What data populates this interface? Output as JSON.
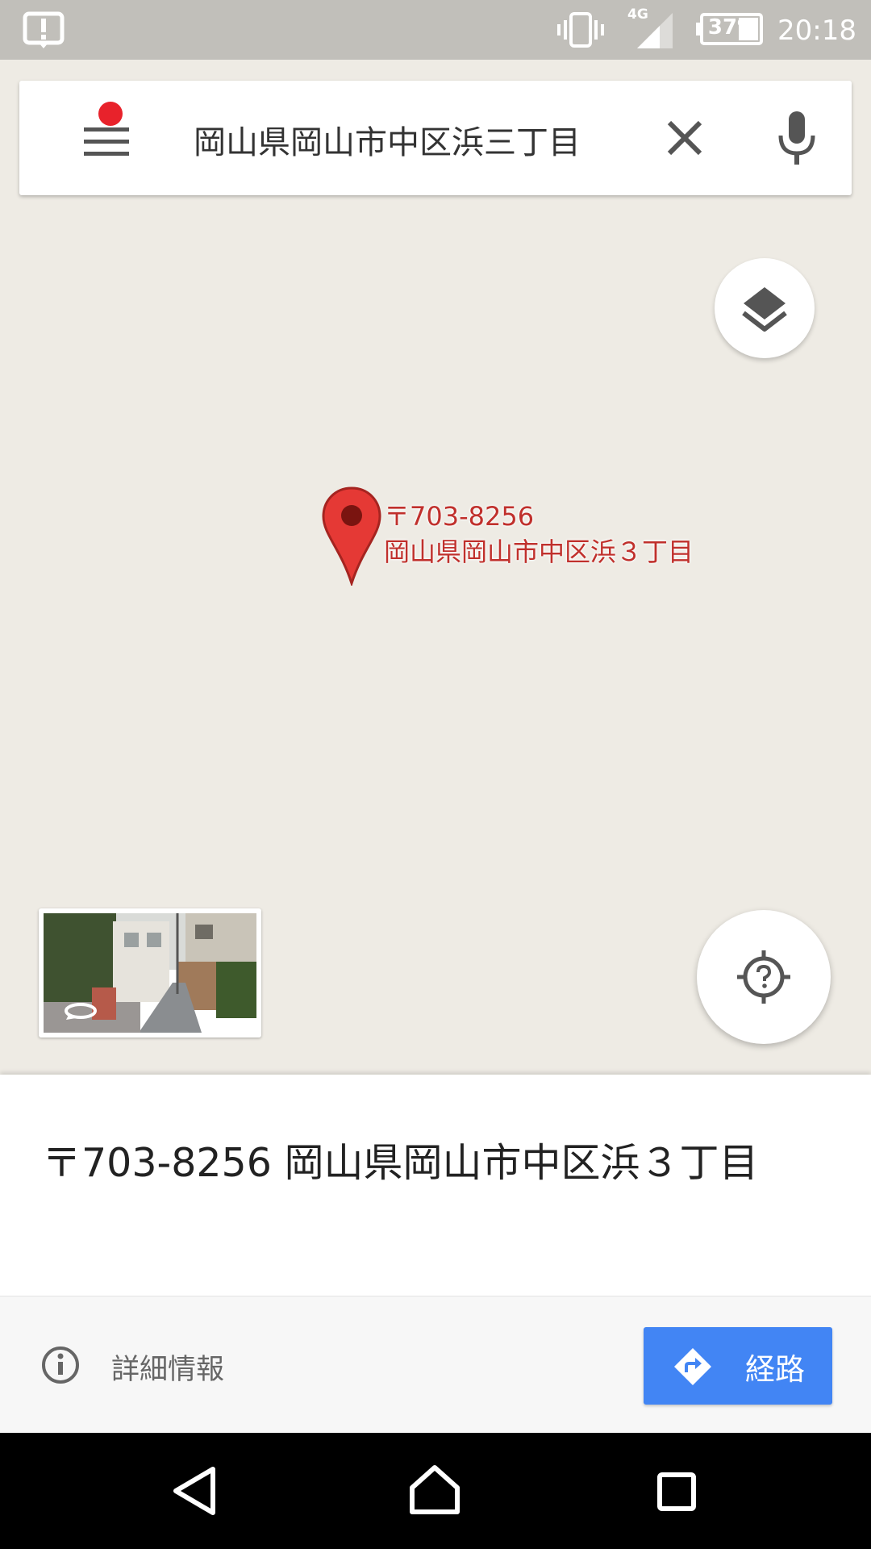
{
  "status_bar": {
    "alert_icon": "notification-alert-icon",
    "vibrate_icon": "vibrate-icon",
    "network_type": "4G",
    "signal_icon": "cell-signal-icon",
    "battery_percent": "37%",
    "battery_icon": "battery-icon",
    "time": "20:18"
  },
  "search": {
    "menu_icon": "hamburger-menu-icon",
    "query": "岡山県岡山市中区浜三丁目",
    "clear_icon": "close-icon",
    "mic_icon": "microphone-icon"
  },
  "map": {
    "layers_icon": "layers-icon",
    "pin": {
      "postal": "〒703-8256",
      "address": "岡山県岡山市中区浜３丁目"
    },
    "street_view_icon": "street-view-rotate-icon",
    "my_location_icon": "location-unknown-icon"
  },
  "place_sheet": {
    "address": "〒703-8256 岡山県岡山市中区浜３丁目",
    "details_label": "詳細情報",
    "details_icon": "info-icon",
    "route_label": "経路",
    "route_icon": "directions-icon",
    "accent_color": "#4285f4",
    "pin_color": "#e53935"
  },
  "nav_bar": {
    "back_icon": "back-triangle-icon",
    "home_icon": "home-icon",
    "recents_icon": "recents-square-icon"
  }
}
